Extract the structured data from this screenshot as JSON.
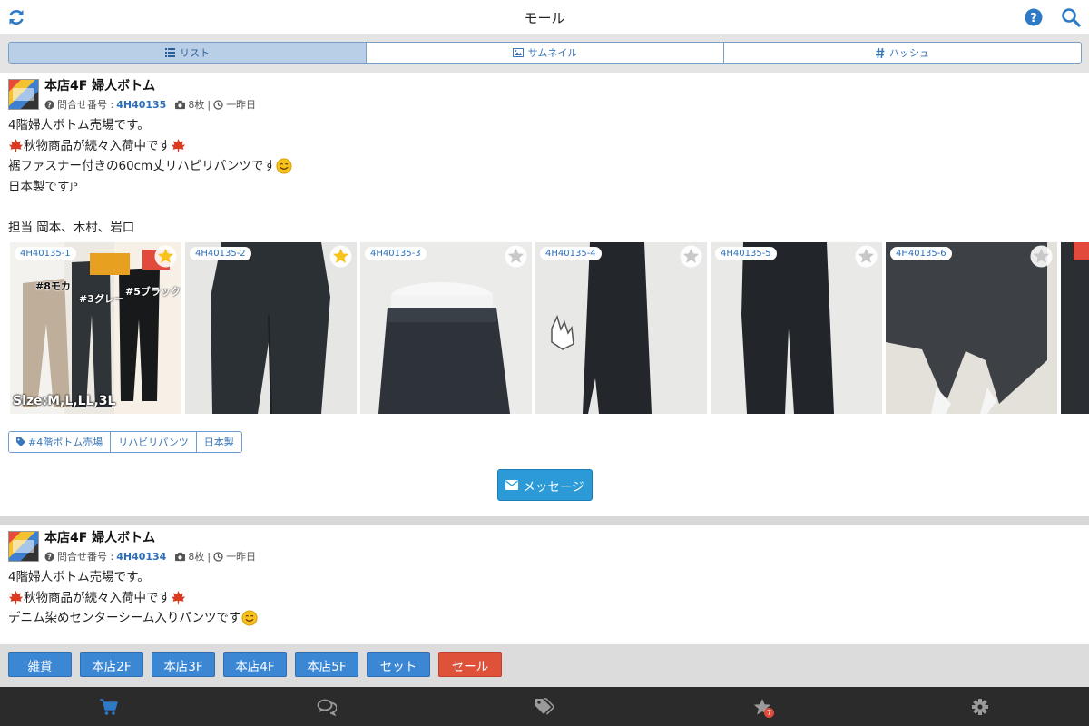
{
  "header": {
    "title": "モール"
  },
  "view_tabs": [
    {
      "label": "リスト",
      "icon": "list-icon",
      "active": true
    },
    {
      "label": "サムネイル",
      "icon": "image-icon",
      "active": false
    },
    {
      "label": "ハッシュ",
      "icon": "hash-icon",
      "active": false
    }
  ],
  "posts": [
    {
      "shop": "本店4F 婦人ボトム",
      "inquiry_label": "問合せ番号 :",
      "inquiry_no": "4H40135",
      "photo_count": "8枚",
      "separator": "|",
      "time": "一昨日",
      "body": [
        "4階婦人ボトム売場です。",
        "秋物商品が続々入荷中です",
        "裾ファスナー付きの60cm丈リハビリパンツです",
        "日本製です",
        "",
        "担当 岡本、木村、岩口"
      ],
      "body_suffix_jp": "JP",
      "images": [
        {
          "label": "4H40135-1",
          "starred": true,
          "overlay_texts": [
            "#8モカ",
            "#3グレー",
            "#5ブラック",
            "Size:M,L,LL,3L"
          ]
        },
        {
          "label": "4H40135-2",
          "starred": true
        },
        {
          "label": "4H40135-3",
          "starred": false
        },
        {
          "label": "4H40135-4",
          "starred": false
        },
        {
          "label": "4H40135-5",
          "starred": false
        },
        {
          "label": "4H40135-6",
          "starred": false
        }
      ],
      "tags": [
        "#4階ボトム売場",
        "リハビリパンツ",
        "日本製"
      ],
      "message_button": "メッセージ"
    },
    {
      "shop": "本店4F 婦人ボトム",
      "inquiry_label": "問合せ番号 :",
      "inquiry_no": "4H40134",
      "photo_count": "8枚",
      "separator": "|",
      "time": "一昨日",
      "body": [
        "4階婦人ボトム売場です。",
        "秋物商品が続々入荷中です",
        "デニム染めセンターシーム入りパンツです"
      ]
    }
  ],
  "categories": [
    {
      "label": "雑貨",
      "type": "normal"
    },
    {
      "label": "本店2F",
      "type": "normal"
    },
    {
      "label": "本店3F",
      "type": "normal"
    },
    {
      "label": "本店4F",
      "type": "normal"
    },
    {
      "label": "本店5F",
      "type": "normal"
    },
    {
      "label": "セット",
      "type": "normal"
    },
    {
      "label": "セール",
      "type": "sale"
    }
  ],
  "bottom_nav": [
    {
      "name": "cart-icon"
    },
    {
      "name": "comments-icon"
    },
    {
      "name": "tags-icon"
    },
    {
      "name": "star-icon",
      "badge": "7"
    },
    {
      "name": "gear-icon"
    }
  ],
  "colors": {
    "accent": "#2c6fb7",
    "category_button": "#3c87d4",
    "sale_button": "#e0513a",
    "nav_bg": "#2b2b2b",
    "star_active": "#f7c21b"
  }
}
